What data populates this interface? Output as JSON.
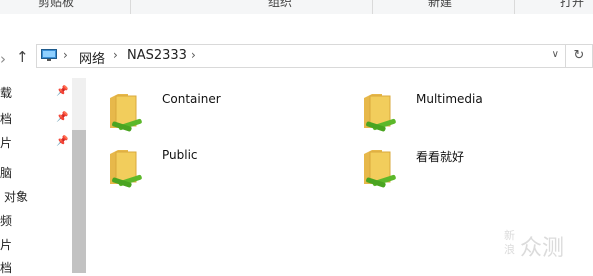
{
  "ribbon": {
    "groups": [
      "剪贴板",
      "组织",
      "新建",
      "打开"
    ]
  },
  "navigation": {
    "back_icon": "back-arrow-icon",
    "forward_icon": "forward-arrow-icon",
    "up_icon": "up-arrow-icon",
    "breadcrumb": [
      "网络",
      "NAS2333"
    ],
    "refresh_icon": "refresh-icon"
  },
  "nav_pane": {
    "items": [
      "载",
      "档",
      "片",
      "脑",
      "对象",
      "频",
      "片",
      "档"
    ]
  },
  "files": [
    {
      "name": "Container",
      "icon": "network-share-folder-icon"
    },
    {
      "name": "Multimedia",
      "icon": "network-share-folder-icon"
    },
    {
      "name": "Public",
      "icon": "network-share-folder-icon"
    },
    {
      "name": "看看就好",
      "icon": "network-share-folder-icon"
    }
  ],
  "watermark": {
    "line1": "新",
    "line2": "浪",
    "text": "众测"
  },
  "colors": {
    "folder": "#f2cd5c",
    "share_cable": "#5cb82a"
  }
}
